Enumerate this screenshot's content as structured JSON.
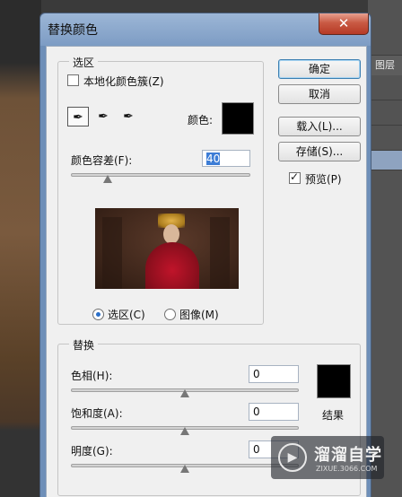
{
  "background": {
    "layers_tab_label": "图层"
  },
  "dialog": {
    "title": "替换颜色",
    "close_glyph": "✕",
    "selection_group": {
      "label": "选区",
      "localized_clusters_label": "本地化颜色簇(Z)",
      "localized_clusters_checked": false,
      "tools": [
        "eyedropper-icon",
        "eyedropper-plus-icon",
        "eyedropper-minus-icon"
      ],
      "tool_glyphs": [
        "✒",
        "✒",
        "✒"
      ],
      "active_tool": "eyedropper-icon",
      "color_label": "颜色:",
      "color_value": "#000000",
      "fuzziness_label": "颜色容差(F):",
      "fuzziness_value": "40",
      "fuzziness_fraction": 0.2,
      "radio_selection_label": "选区(C)",
      "radio_image_label": "图像(M)",
      "view_mode": "selection"
    },
    "replacement_group": {
      "label": "替换",
      "hue_label": "色相(H):",
      "hue_value": "0",
      "hue_fraction": 0.5,
      "saturation_label": "饱和度(A):",
      "saturation_value": "0",
      "saturation_fraction": 0.5,
      "lightness_label": "明度(G):",
      "lightness_value": "0",
      "lightness_fraction": 0.5,
      "result_label": "结果",
      "result_color": "#000000"
    },
    "buttons": {
      "ok": "确定",
      "cancel": "取消",
      "load": "载入(L)...",
      "save": "存储(S)...",
      "preview_label": "预览(P)",
      "preview_checked": true
    }
  },
  "watermark": {
    "title": "溜溜自学",
    "subtitle": "ZIXUE.3066.COM"
  }
}
